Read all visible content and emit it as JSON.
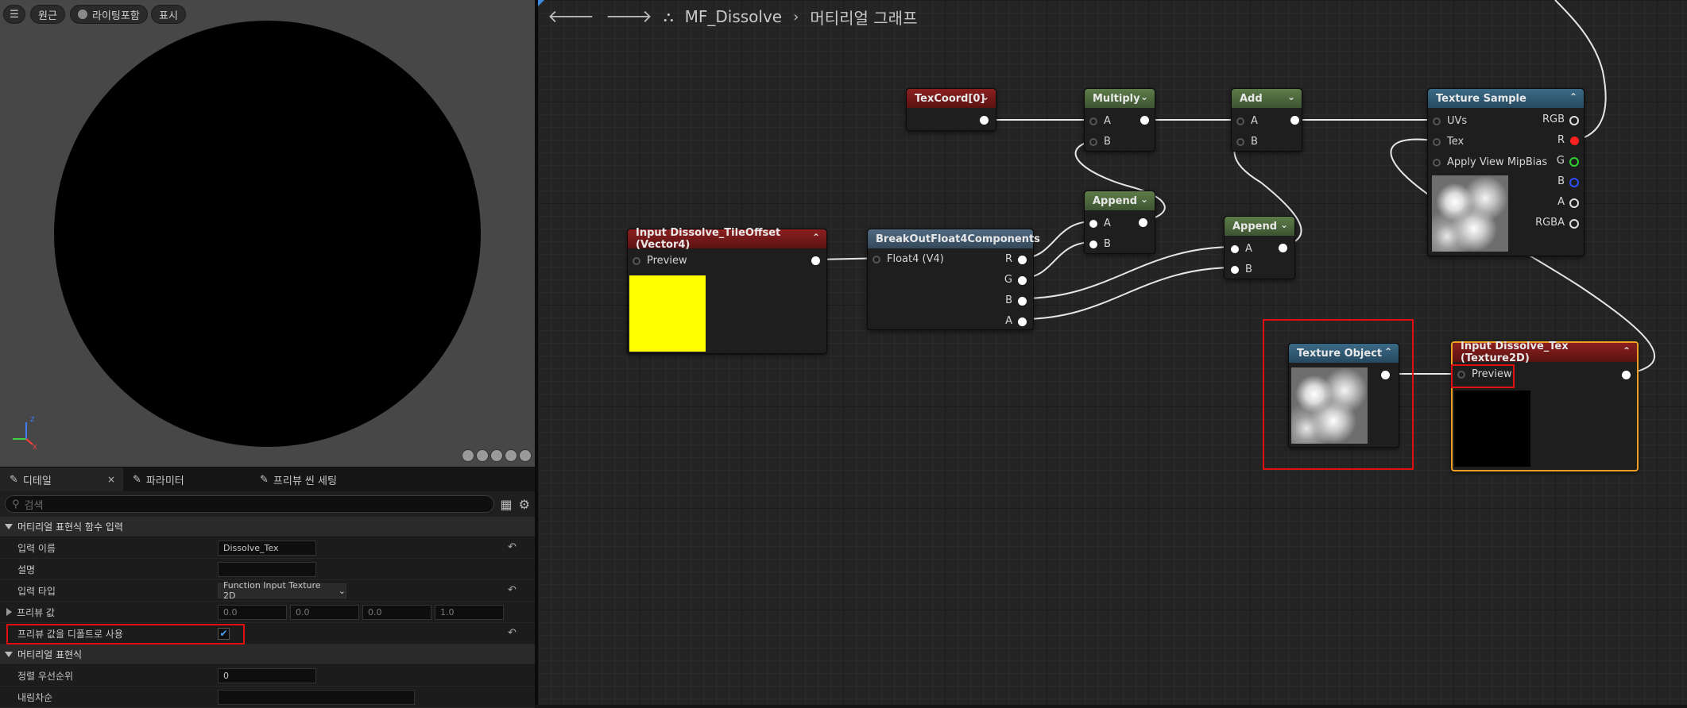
{
  "viewport": {
    "buttons": {
      "menu": "☰",
      "perspective": "원근",
      "lighting": "라이팅포함",
      "show": "표시"
    }
  },
  "details": {
    "tabs": [
      {
        "label": "디테일",
        "close": "×"
      },
      {
        "label": "파라미터"
      },
      {
        "label": "프리뷰 씬 세팅"
      }
    ],
    "search_placeholder": "검색",
    "section1": "머티리얼 표현식 함수 입력",
    "rows": {
      "input_name": {
        "label": "입력 이름",
        "value": "Dissolve_Tex"
      },
      "description": {
        "label": "설명",
        "value": ""
      },
      "input_type": {
        "label": "입력 타입",
        "value": "Function Input Texture 2D"
      },
      "preview_value": {
        "label": "프리뷰 값",
        "values": [
          "0.0",
          "0.0",
          "0.0",
          "1.0"
        ]
      },
      "use_preview_default": {
        "label": "프리뷰 값을 디폴트로 사용",
        "checked": true
      }
    },
    "section2": "머티리얼 표현식",
    "rows2": {
      "sort_priority": {
        "label": "정렬 우선순위",
        "value": "0"
      },
      "desc2": {
        "label": "내림차순",
        "value": ""
      }
    }
  },
  "graph": {
    "breadcrumb": {
      "asset": "MF_Dissolve",
      "graph": "머티리얼 그래프"
    },
    "nodes": {
      "texcoord": {
        "title": "TexCoord[0]"
      },
      "multiply": {
        "title": "Multiply",
        "pins": [
          "A",
          "B"
        ]
      },
      "add": {
        "title": "Add",
        "pins": [
          "A",
          "B"
        ]
      },
      "texture_sample": {
        "title": "Texture Sample",
        "inputs": [
          "UVs",
          "Tex",
          "Apply View MipBias"
        ],
        "outputs": [
          "RGB",
          "R",
          "G",
          "B",
          "A",
          "RGBA"
        ]
      },
      "append1": {
        "title": "Append",
        "pins": [
          "A",
          "B"
        ]
      },
      "append2": {
        "title": "Append",
        "pins": [
          "A",
          "B"
        ]
      },
      "input_tileoffset": {
        "title": "Input Dissolve_TileOffset (Vector4)",
        "pin": "Preview",
        "preview_color": "#ffff00"
      },
      "breakout": {
        "title": "BreakOutFloat4Components",
        "input": "Float4 (V4)",
        "outputs": [
          "R",
          "G",
          "B",
          "A"
        ]
      },
      "texture_object": {
        "title": "Texture Object"
      },
      "input_tex": {
        "title": "Input Dissolve_Tex (Texture2D)",
        "pin": "Preview"
      }
    },
    "colors": {
      "selected": "#f0a020",
      "highlight": "#e01010",
      "pin_r": "#ff2020",
      "pin_g": "#30d030",
      "pin_b": "#3050ff"
    }
  }
}
